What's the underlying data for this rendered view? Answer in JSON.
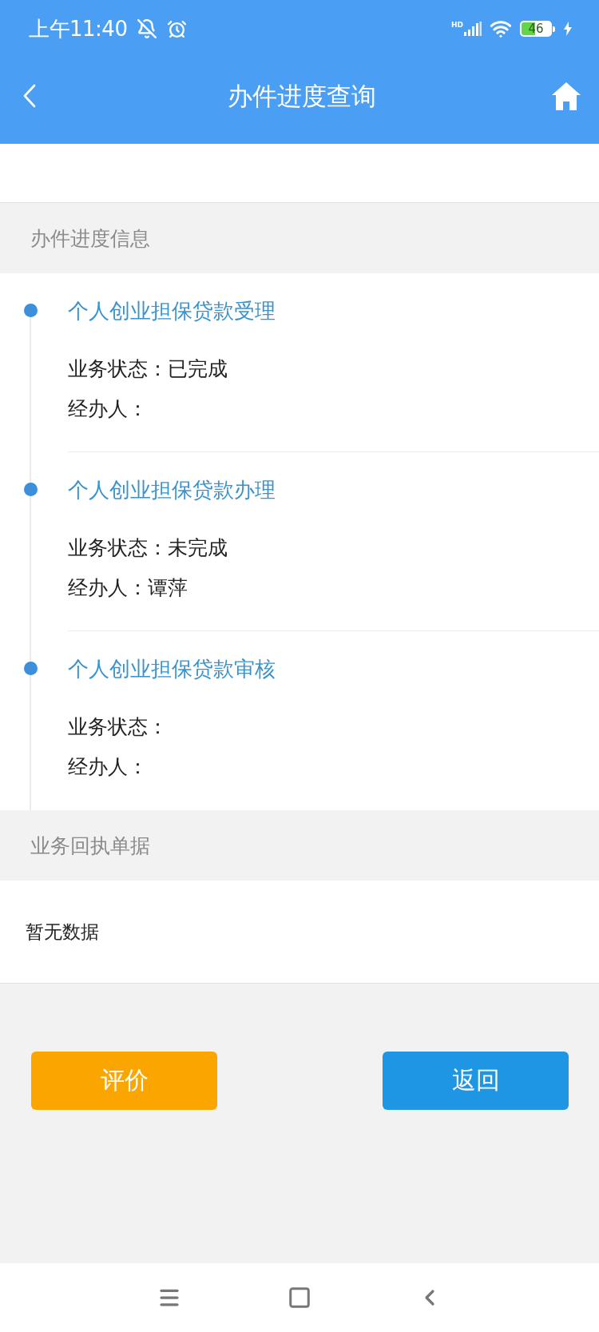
{
  "status_bar": {
    "time": "上午11:40",
    "network_type": "HD",
    "battery": "46"
  },
  "nav_bar": {
    "title": "办件进度查询"
  },
  "progress": {
    "heading": "办件进度信息",
    "steps": [
      {
        "title": "个人创业担保贷款受理",
        "lines": [
          "业务状态：已完成",
          "经办人："
        ]
      },
      {
        "title": "个人创业担保贷款办理",
        "lines": [
          "业务状态：未完成",
          "经办人：谭萍"
        ]
      },
      {
        "title": "个人创业担保贷款审核",
        "lines": [
          "业务状态：",
          "经办人："
        ]
      }
    ]
  },
  "receipt": {
    "heading": "业务回执单据",
    "empty_text": "暂无数据"
  },
  "actions": [
    {
      "label": "评价",
      "color": "#fba600"
    },
    {
      "label": "返回",
      "color": "#1e96e3"
    }
  ]
}
